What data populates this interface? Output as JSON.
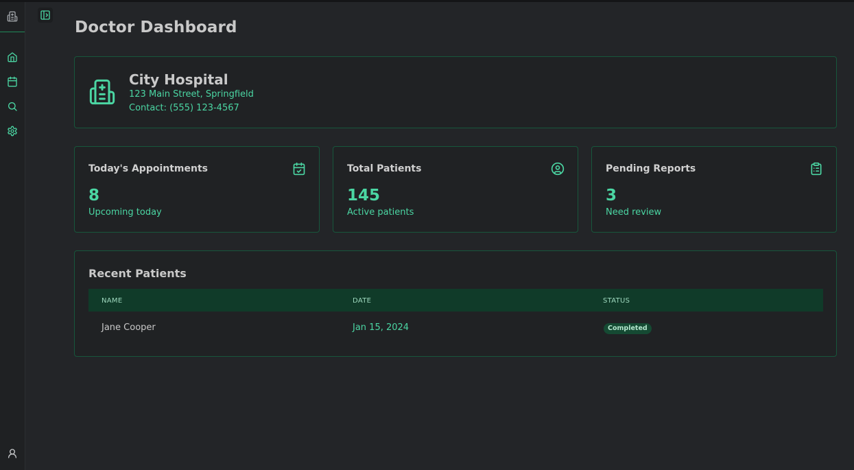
{
  "page": {
    "title": "Doctor Dashboard"
  },
  "sidebar": {
    "items": [
      {
        "name": "home",
        "icon": "home-icon"
      },
      {
        "name": "appointments",
        "icon": "calendar-icon"
      },
      {
        "name": "search",
        "icon": "search-icon"
      },
      {
        "name": "settings",
        "icon": "gear-icon"
      }
    ],
    "user_icon": "user-icon"
  },
  "hospital": {
    "name": "City Hospital",
    "address": "123 Main Street, Springfield",
    "contact": "Contact: (555) 123-4567",
    "icon": "hospital-icon"
  },
  "stats": [
    {
      "title": "Today's Appointments",
      "value": "8",
      "subtitle": "Upcoming today",
      "icon": "calendar-check-icon"
    },
    {
      "title": "Total Patients",
      "value": "145",
      "subtitle": "Active patients",
      "icon": "user-circle-icon"
    },
    {
      "title": "Pending Reports",
      "value": "3",
      "subtitle": "Need review",
      "icon": "clipboard-icon"
    }
  ],
  "recent_patients": {
    "title": "Recent Patients",
    "columns": [
      "NAME",
      "DATE",
      "STATUS"
    ],
    "rows": [
      {
        "name": "Jane Cooper",
        "date": "Jan 15, 2024",
        "status": "Completed"
      }
    ]
  },
  "colors": {
    "accent": "#4bd6a3",
    "background": "#232528",
    "card_border": "#17573c",
    "table_header": "#103b29"
  }
}
